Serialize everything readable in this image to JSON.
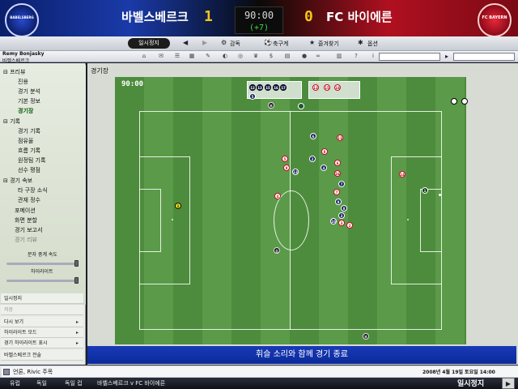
{
  "header": {
    "home_team": "바벨스베르크",
    "away_team": "FC 바이에른",
    "home_score": "1",
    "away_score": "0",
    "clock": "90:00",
    "added_time": "(+7)",
    "home_crest_text": "BABELSBERG",
    "away_crest_text": "FC BAYERN"
  },
  "toolbar": {
    "pause_label": "일시정지",
    "manager_menu": "감독",
    "football_menu": "축구계",
    "favorites_menu": "즐겨찾기",
    "options_menu": "옵션"
  },
  "user": {
    "name": "Remy Bonjasky",
    "club": "바벨스베르크"
  },
  "sidebar": {
    "items": [
      {
        "label": "⊟ 프리뷰",
        "type": "h"
      },
      {
        "label": "진용",
        "type": "sub"
      },
      {
        "label": "경기 분석",
        "type": "sub"
      },
      {
        "label": "기본 정보",
        "type": "sub"
      },
      {
        "label": "경기장",
        "type": "active"
      },
      {
        "label": "⊟ 기록",
        "type": "h"
      },
      {
        "label": "경기 기록",
        "type": "sub"
      },
      {
        "label": "점유율",
        "type": "sub"
      },
      {
        "label": "흐름 기록",
        "type": "sub"
      },
      {
        "label": "원정팀 기록",
        "type": "sub"
      },
      {
        "label": "선수 평점",
        "type": "sub"
      },
      {
        "label": "⊟ 경기 속보",
        "type": "h"
      },
      {
        "label": "타 구장 소식",
        "type": "sub"
      },
      {
        "label": "관재 정수",
        "type": "sub"
      },
      {
        "label": "포메이션",
        "type": "h2"
      },
      {
        "label": "화면 분할",
        "type": "h2"
      },
      {
        "label": "경기 보고서",
        "type": "h2"
      },
      {
        "label": "경기 리뷰",
        "type": "dis"
      }
    ],
    "slider1_label": "문자 중계 속도",
    "slider2_label": "하이라이트"
  },
  "actions": [
    {
      "label": "일시정지",
      "arrow": "",
      "dim": false
    },
    {
      "label": "저장",
      "arrow": "",
      "dim": true
    },
    {
      "label": "다시 보기",
      "arrow": "▸",
      "dim": false
    },
    {
      "label": "하이라이트 모드",
      "arrow": "▸",
      "dim": false
    },
    {
      "label": "경기 하이라이트 표시",
      "arrow": "▸",
      "dim": false
    },
    {
      "label": "바벨스베르크 전술",
      "arrow": "",
      "dim": false
    }
  ],
  "main": {
    "section_title": "경기장",
    "match_time": "90:00",
    "commentary": "휘슬 소리와 함께 경기 종료"
  },
  "bench_home": [
    "12",
    "13",
    "15",
    "16",
    "17"
  ],
  "bench_away": [
    "12",
    "15",
    "18"
  ],
  "players": [
    {
      "n": "1",
      "side": "gk-home"
    },
    {
      "n": "6",
      "side": "home"
    },
    {
      "n": "2",
      "side": "home"
    },
    {
      "n": "13",
      "side": "home"
    },
    {
      "n": "4",
      "side": "home"
    },
    {
      "n": "7",
      "side": "home"
    },
    {
      "n": "10",
      "side": "home"
    },
    {
      "n": "8",
      "side": "home"
    },
    {
      "n": "9",
      "side": "home"
    },
    {
      "n": "3",
      "side": "home"
    },
    {
      "n": "5",
      "side": "home"
    },
    {
      "n": "1",
      "side": "gk-away"
    },
    {
      "n": "11",
      "side": "away"
    },
    {
      "n": "8",
      "side": "away"
    },
    {
      "n": "6",
      "side": "away"
    },
    {
      "n": "5",
      "side": "away"
    },
    {
      "n": "16",
      "side": "away"
    },
    {
      "n": "4",
      "side": "away"
    },
    {
      "n": "14",
      "side": "away"
    },
    {
      "n": "9",
      "side": "away"
    },
    {
      "n": "7",
      "side": "away"
    },
    {
      "n": "3",
      "side": "away"
    },
    {
      "n": "2",
      "side": "away"
    },
    {
      "n": "심",
      "side": "ref"
    },
    {
      "n": "부",
      "side": "ref"
    },
    {
      "n": "부",
      "side": "ref"
    }
  ],
  "news": "언론, Rivic 주목",
  "datetime": "2008년 4월 19일 토요일 14:00",
  "crumbs": [
    "유럽",
    "독일",
    "독일 컵",
    "바벨스베르크 v FC 바이에른"
  ],
  "bottom_pause": "일시정지",
  "colors": {
    "home": "#12205a",
    "away": "#c01020",
    "pitch": "#4d8c3c",
    "commentary_bg": "#1a3ab8"
  }
}
